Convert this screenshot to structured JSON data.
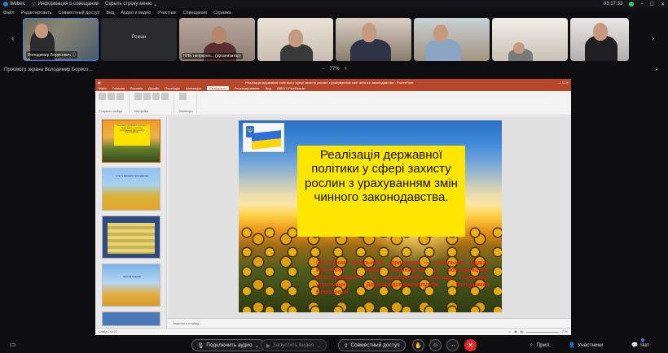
{
  "titlebar": {
    "app": "Webex",
    "meeting_info": "Информация о совещании",
    "hide_menu": "Скрыть строку меню",
    "time": "03:17:33"
  },
  "menu": [
    "Файл",
    "Редактировать",
    "Совместный доступ",
    "Вид",
    "Аудио и видео",
    "Участник",
    "Совещание",
    "Справка"
  ],
  "participants": [
    {
      "name": "Володимир Борисович"
    },
    {
      "name": "Роман"
    },
    {
      "name": "ННЕ непркрен... (организатор)"
    },
    {
      "name": ""
    },
    {
      "name": ""
    },
    {
      "name": ""
    },
    {
      "name": ""
    },
    {
      "name": ""
    }
  ],
  "viewer": {
    "title": "Просмотр экрана Володимир Борисо...",
    "zoom": "77%",
    "zoom_minus": "−",
    "zoom_plus": "+"
  },
  "ppt": {
    "title": "Реалізація державної політики у сфері захисту рослин з урахуванням змін чинного законодавства - PowerPoint",
    "tabs": [
      "Файл",
      "Главная",
      "Вставка",
      "Дизайн",
      "Переходы",
      "Анимация",
      "Слайд-шоу",
      "Рецензирование",
      "Вид",
      "ABBYY FineReader"
    ],
    "active_tab": "Слайд-шоу",
    "ribbon": {
      "group1": "С первого слайда",
      "group2": "С текущего слайда",
      "group3": "Настройка",
      "group4": "Мониторы"
    },
    "notes_placeholder": "Заметки к слайду",
    "status_left": "Слайд 1 из 22",
    "status_zoom": "77%"
  },
  "slide": {
    "title": "Реалізація державної політики у сфері захисту рослин з урахуванням змін чинного законодавства.",
    "author": "Заступник начальника управління — начальник відділу контролю у сфері насінництва та розсадництва, фітосанітарного та карантинного нагляду Головного управління Держпродспоживслужби Володимир Борисович"
  },
  "thumbs": [
    {
      "num": "1",
      "text": "Реалізація державної політики у сфері захисту рослин з урахуванням змін чинного законодавства"
    },
    {
      "num": "2",
      "text": "Стан та виконання законодавства"
    },
    {
      "num": "3",
      "text": ""
    },
    {
      "num": "4",
      "text": "Шкідливі організми"
    },
    {
      "num": "5",
      "text": ""
    }
  ],
  "controls": {
    "audio": "Подключить аудио",
    "video": "Запустить видео",
    "share": "Совместный доступ",
    "apps": "Прил.",
    "participants": "Участники",
    "chat": "Чат"
  },
  "colors": {
    "end_call": "#e32a2a",
    "ppt_brand": "#b7472a",
    "slide_title_bg": "#ffe600",
    "author_text": "#e51b1b"
  }
}
